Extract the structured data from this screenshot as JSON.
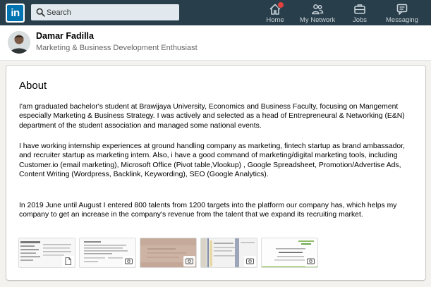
{
  "nav": {
    "logo_text": "in",
    "search_placeholder": "Search",
    "items": [
      {
        "label": "Home",
        "icon": "home-icon"
      },
      {
        "label": "My Network",
        "icon": "network-icon"
      },
      {
        "label": "Jobs",
        "icon": "jobs-icon"
      },
      {
        "label": "Messaging",
        "icon": "messaging-icon"
      }
    ],
    "brand_color": "#283e4a",
    "accent_color": "#0073b1",
    "badge_color": "#e0413d"
  },
  "profile": {
    "name": "Damar Fadilla",
    "headline": "Marketing & Business Development Enthusiast"
  },
  "about": {
    "title": "About",
    "paragraphs": [
      "I'am graduated bachelor's student at Brawijaya University, Economics and Business Faculty, focusing on Mangement especially Marketing & Business Strategy. I was actively and selected as a head of Entrepreneural & Networking (E&N) department of the student association and managed some national events.",
      "I have working internship experiences at ground handling company as marketing, fintech startup as brand ambassador, and recruiter startup as marketing intern. Also, i have a good command of marketing/digital marketing tools, including Customer.io (email marketing), Microsoft Office (Pivot table,Vlookup) , Google Spreadsheet, Promotion/Advertise Ads, Content Writing (Wordpress, Backlink, Keywording), SEO (Google Analytics).",
      "In 2019 June until August I entered 800 talents from 1200 targets into the platform our company has, which helps my company to get an increase in the company's revenue from the talent that we expand its recruiting market."
    ],
    "media": [
      {
        "icon": "document-icon"
      },
      {
        "icon": "image-icon"
      },
      {
        "icon": "image-icon"
      },
      {
        "icon": "image-icon"
      },
      {
        "icon": "image-icon"
      }
    ]
  }
}
